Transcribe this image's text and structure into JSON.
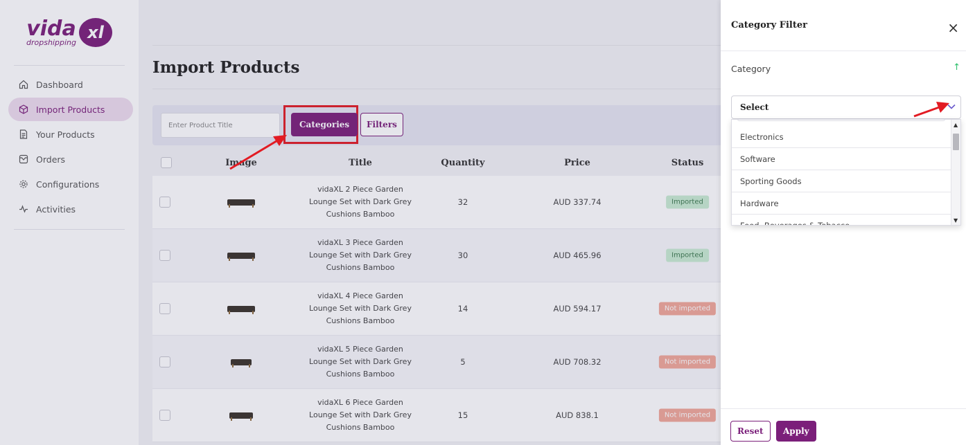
{
  "brand": {
    "name": "vida",
    "badge": "xl",
    "sub": "dropshipping",
    "color": "#7b1f7a"
  },
  "sidebar": {
    "items": [
      {
        "label": "Dashboard",
        "icon": "home-icon",
        "active": false
      },
      {
        "label": "Import Products",
        "icon": "cube-icon",
        "active": true
      },
      {
        "label": "Your Products",
        "icon": "document-icon",
        "active": false
      },
      {
        "label": "Orders",
        "icon": "inbox-icon",
        "active": false
      },
      {
        "label": "Configurations",
        "icon": "gear-icon",
        "active": false
      },
      {
        "label": "Activities",
        "icon": "activity-icon",
        "active": false
      }
    ]
  },
  "main": {
    "title": "Import Products",
    "search_placeholder": "Enter Product Title",
    "categories_label": "Categories",
    "filters_label": "Filters"
  },
  "table": {
    "headers": {
      "image": "Image",
      "title": "Title",
      "quantity": "Quantity",
      "price": "Price",
      "status": "Status"
    },
    "rows": [
      {
        "title": "vidaXL 2 Piece Garden Lounge Set with Dark Grey Cushions Bamboo",
        "quantity": "32",
        "price": "AUD 337.74",
        "status": "Imported"
      },
      {
        "title": "vidaXL 3 Piece Garden Lounge Set with Dark Grey Cushions Bamboo",
        "quantity": "30",
        "price": "AUD 465.96",
        "status": "Imported"
      },
      {
        "title": "vidaXL 4 Piece Garden Lounge Set with Dark Grey Cushions Bamboo",
        "quantity": "14",
        "price": "AUD 594.17",
        "status": "Not imported"
      },
      {
        "title": "vidaXL 5 Piece Garden Lounge Set with Dark Grey Cushions Bamboo",
        "quantity": "5",
        "price": "AUD 708.32",
        "status": "Not imported"
      },
      {
        "title": "vidaXL 6 Piece Garden Lounge Set with Dark Grey Cushions Bamboo",
        "quantity": "15",
        "price": "AUD 838.1",
        "status": "Not imported"
      }
    ]
  },
  "drawer": {
    "title": "Category Filter",
    "close": "×",
    "category_label": "Category",
    "select_placeholder": "Select",
    "options": [
      "Electronics",
      "Software",
      "Sporting Goods",
      "Hardware",
      "Food, Beverages & Tobacco"
    ],
    "reset_label": "Reset",
    "apply_label": "Apply"
  },
  "colors": {
    "accent": "#7b1f7a",
    "annotation": "#e21b23",
    "imported": "#c9ecd2",
    "not_imported": "#f2a899"
  }
}
